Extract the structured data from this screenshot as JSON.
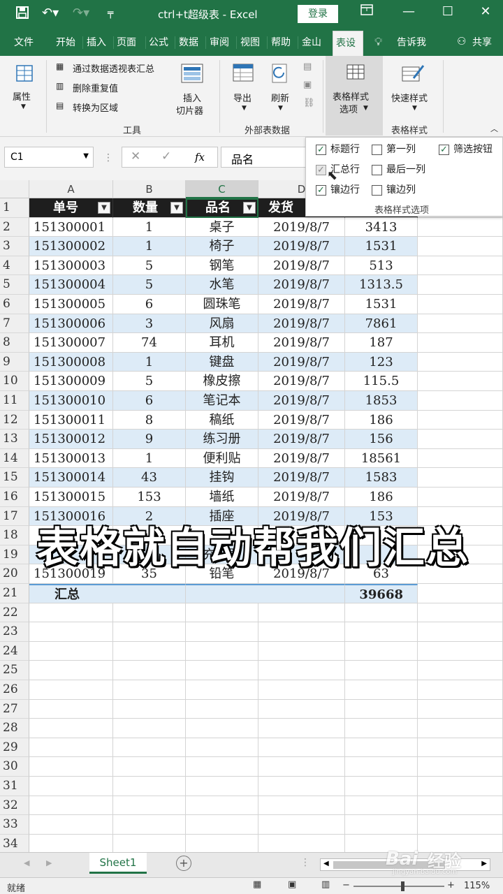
{
  "titlebar": {
    "title": "ctrl+t超级表 - Excel",
    "login_label": "登录"
  },
  "tabs": [
    {
      "label": "文件"
    },
    {
      "label": "开始"
    },
    {
      "label": "插入"
    },
    {
      "label": "页面"
    },
    {
      "label": "公式"
    },
    {
      "label": "数据"
    },
    {
      "label": "审阅"
    },
    {
      "label": "视图"
    },
    {
      "label": "帮助"
    },
    {
      "label": "金山"
    },
    {
      "label": "表设"
    },
    {
      "label": "告诉我"
    },
    {
      "label": "共享"
    }
  ],
  "ribbon": {
    "properties_label": "属性",
    "pivot_label": "通过数据透视表汇总",
    "remove_dup_label": "删除重复值",
    "convert_label": "转换为区域",
    "slicer_line1": "插入",
    "slicer_line2": "切片器",
    "tools_group": "工具",
    "export_label": "导出",
    "refresh_label": "刷新",
    "external_group": "外部表数据",
    "style_options_line1": "表格样式",
    "style_options_line2": "选项",
    "quick_styles_label": "快速样式",
    "table_styles_group": "表格样式"
  },
  "formula_bar": {
    "name_box": "C1",
    "formula": "品名"
  },
  "options_panel": {
    "header_row": {
      "label": "标题行",
      "checked": true
    },
    "first_column": {
      "label": "第一列",
      "checked": false
    },
    "filter_button": {
      "label": "筛选按钮",
      "checked": true
    },
    "total_row": {
      "label": "汇总行",
      "checked": true
    },
    "last_column": {
      "label": "最后一列",
      "checked": false
    },
    "banded_rows": {
      "label": "镶边行",
      "checked": true
    },
    "banded_columns": {
      "label": "镶边列",
      "checked": false
    },
    "group_label": "表格样式选项"
  },
  "grid": {
    "column_letters": [
      "A",
      "B",
      "C",
      "D"
    ],
    "headers": [
      "单号",
      "数量",
      "品名",
      "发货"
    ],
    "rows": [
      {
        "n": "2",
        "a": "151300001",
        "b": "1",
        "c": "桌子",
        "d": "2019/8/7",
        "e": "3413"
      },
      {
        "n": "3",
        "a": "151300002",
        "b": "1",
        "c": "椅子",
        "d": "2019/8/7",
        "e": "1531"
      },
      {
        "n": "4",
        "a": "151300003",
        "b": "5",
        "c": "钢笔",
        "d": "2019/8/7",
        "e": "513"
      },
      {
        "n": "5",
        "a": "151300004",
        "b": "5",
        "c": "水笔",
        "d": "2019/8/7",
        "e": "1313.5"
      },
      {
        "n": "6",
        "a": "151300005",
        "b": "6",
        "c": "圆珠笔",
        "d": "2019/8/7",
        "e": "1531"
      },
      {
        "n": "7",
        "a": "151300006",
        "b": "3",
        "c": "风扇",
        "d": "2019/8/7",
        "e": "7861"
      },
      {
        "n": "8",
        "a": "151300007",
        "b": "74",
        "c": "耳机",
        "d": "2019/8/7",
        "e": "187"
      },
      {
        "n": "9",
        "a": "151300008",
        "b": "1",
        "c": "键盘",
        "d": "2019/8/7",
        "e": "123"
      },
      {
        "n": "10",
        "a": "151300009",
        "b": "5",
        "c": "橡皮擦",
        "d": "2019/8/7",
        "e": "115.5"
      },
      {
        "n": "11",
        "a": "151300010",
        "b": "6",
        "c": "笔记本",
        "d": "2019/8/7",
        "e": "1853"
      },
      {
        "n": "12",
        "a": "151300011",
        "b": "8",
        "c": "稿纸",
        "d": "2019/8/7",
        "e": "186"
      },
      {
        "n": "13",
        "a": "151300012",
        "b": "9",
        "c": "练习册",
        "d": "2019/8/7",
        "e": "156"
      },
      {
        "n": "14",
        "a": "151300013",
        "b": "1",
        "c": "便利贴",
        "d": "2019/8/7",
        "e": "18561"
      },
      {
        "n": "15",
        "a": "151300014",
        "b": "43",
        "c": "挂钩",
        "d": "2019/8/7",
        "e": "1583"
      },
      {
        "n": "16",
        "a": "151300015",
        "b": "153",
        "c": "墙纸",
        "d": "2019/8/7",
        "e": "186"
      },
      {
        "n": "17",
        "a": "151300016",
        "b": "2",
        "c": "插座",
        "d": "2019/8/7",
        "e": "153"
      },
      {
        "n": "18",
        "a": "",
        "b": "",
        "c": "",
        "d": "",
        "e": ""
      },
      {
        "n": "19",
        "a": "",
        "b": "",
        "c": "充电器",
        "d": "",
        "e": ""
      },
      {
        "n": "20",
        "a": "151300019",
        "b": "35",
        "c": "铅笔",
        "d": "2019/8/7",
        "e": "63"
      }
    ],
    "total_row": {
      "n": "21",
      "label": "汇总",
      "value": "39668"
    },
    "empty_rows": [
      "22",
      "23",
      "24",
      "25",
      "26",
      "27",
      "28",
      "29",
      "30",
      "31",
      "32",
      "33",
      "34"
    ]
  },
  "caption": "表格就自动帮我们汇总",
  "sheet_tab": "Sheet1",
  "status": {
    "left": "就绪",
    "zoom": "115%"
  },
  "watermark": {
    "brand": "Bai",
    "brand2": "经验",
    "url": "jingyan.baidu.com"
  }
}
